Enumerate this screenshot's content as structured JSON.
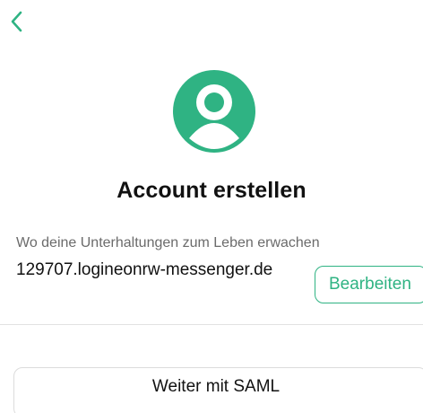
{
  "colors": {
    "accent": "#2fb383"
  },
  "header": {
    "back_icon": "chevron-left-icon"
  },
  "avatar": {
    "icon": "person-icon"
  },
  "title": "Account erstellen",
  "server": {
    "subtitle": "Wo deine Unterhaltungen zum Leben erwachen",
    "domain": "129707.logineonrw-messenger.de",
    "edit_label": "Bearbeiten"
  },
  "actions": {
    "saml_label": "Weiter mit SAML"
  }
}
